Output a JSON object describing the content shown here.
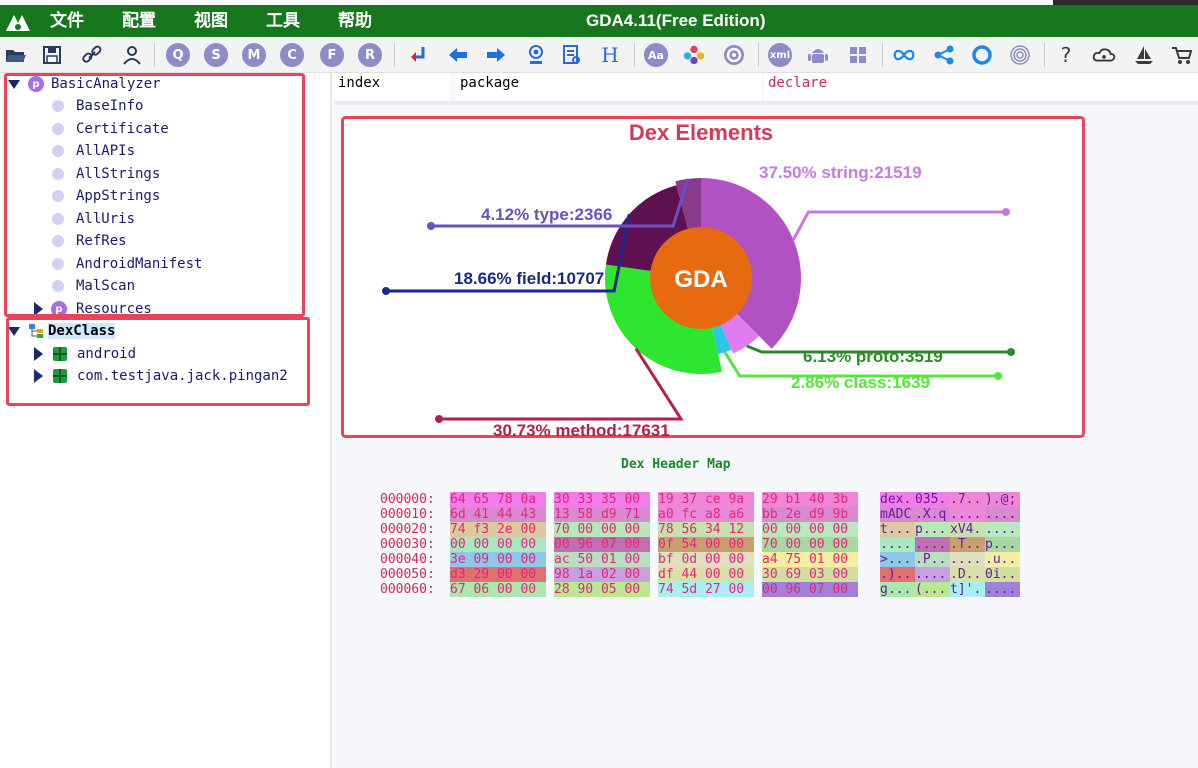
{
  "window": {
    "title": "GDA4.11(Free Edition)",
    "menu": [
      "文件",
      "配置",
      "视图",
      "工具",
      "帮助"
    ]
  },
  "toolbar": {
    "icons": [
      "open-folder-icon",
      "save-icon",
      "link-icon",
      "user-icon",
      "q-icon",
      "s-icon",
      "m-icon",
      "c-icon",
      "f-icon",
      "r-icon",
      "return-icon",
      "back-arrow-icon",
      "forward-arrow-icon",
      "location-icon",
      "report-icon",
      "h-icon",
      "aa-icon",
      "palette-icon",
      "settings-icon",
      "xml-icon",
      "android-icon",
      "windows-icon",
      "infinity-icon",
      "share-icon",
      "circle-icon",
      "fingerprint-icon",
      "help-icon",
      "cloud-icon",
      "boat-icon",
      "cart-icon"
    ],
    "letter_buttons": [
      "Q",
      "S",
      "M",
      "C",
      "F",
      "R"
    ],
    "help_glyph": "?",
    "h_glyph": "H",
    "aa_glyph": "Aa",
    "xml_glyph": "xml"
  },
  "tree": {
    "analyzer": {
      "label": "BasicAnalyzer",
      "children": [
        "BaseInfo",
        "Certificate",
        "AllAPIs",
        "AllStrings",
        "AppStrings",
        "AllUris",
        "RefRes",
        "AndroidManifest",
        "MalScan"
      ],
      "resources": "Resources"
    },
    "dexclass": {
      "label": "DexClass",
      "packages": [
        "android",
        "com.testjava.jack.pingan2"
      ]
    },
    "icon_glyph": "p"
  },
  "columns": [
    "index",
    "package",
    "declare"
  ],
  "chart_data": {
    "type": "pie",
    "title": "Dex Elements",
    "center_label": "GDA",
    "slices": [
      {
        "label": "37.50% string:21519",
        "percent": 37.5,
        "value": 21519,
        "color": "#b052c4",
        "label_color": "#c77be0"
      },
      {
        "label": "6.13% proto:3519",
        "percent": 6.13,
        "value": 3519,
        "color": "#e27af0",
        "label_color": "#2c8a2a"
      },
      {
        "label": "2.86% class:1639",
        "percent": 2.86,
        "value": 1639,
        "color": "#29c6ea",
        "label_color": "#56e63c"
      },
      {
        "label": "30.73% method:17631",
        "percent": 30.73,
        "value": 17631,
        "color": "#2ee630",
        "label_color": "#b3204c"
      },
      {
        "label": "18.66% field:10707",
        "percent": 18.66,
        "value": 10707,
        "color": "#5e1050",
        "label_color": "#1a2a82"
      },
      {
        "label": "4.12% type:2366",
        "percent": 4.12,
        "value": 2366,
        "color": "#8a3a8c",
        "label_color": "#6a50c0"
      }
    ]
  },
  "hexmap": {
    "title": "Dex Header Map",
    "rows": [
      {
        "offset": "000000:",
        "groups": [
          "64 65 78 0a",
          "30 33 35 00",
          "19 37 ce 9a",
          "29 b1 40 3b"
        ],
        "ascii": [
          "dex.",
          "035.",
          ".7..",
          ").@;"
        ]
      },
      {
        "offset": "000010:",
        "groups": [
          "6d 41 44 43",
          "13 58 d9 71",
          "a0 fc a8 a6",
          "bb 2e d9 9b"
        ],
        "ascii": [
          "mADC",
          ".X.q",
          "....",
          "...."
        ]
      },
      {
        "offset": "000020:",
        "groups": [
          "74 f3 2e 00",
          "70 00 00 00",
          "78 56 34 12",
          "00 00 00 00"
        ],
        "ascii": [
          "t...",
          "p...",
          "xV4.",
          "...."
        ]
      },
      {
        "offset": "000030:",
        "groups": [
          "00 00 00 00",
          "00 96 07 00",
          "0f 54 00 00",
          "70 00 00 00"
        ],
        "ascii": [
          "....",
          "....",
          ".T..",
          "p..."
        ]
      },
      {
        "offset": "000040:",
        "groups": [
          "3e 09 00 00",
          "ac 50 01 00",
          "bf 0d 00 00",
          "a4 75 01 00"
        ],
        "ascii": [
          ">...",
          ".P..",
          "....",
          ".u.."
        ]
      },
      {
        "offset": "000050:",
        "groups": [
          "d3 29 00 00",
          "98 1a 02 00",
          "df 44 00 00",
          "30 69 03 00"
        ],
        "ascii": [
          ".)..",
          "....",
          ".D..",
          "0i.."
        ]
      },
      {
        "offset": "000060:",
        "groups": [
          "67 06 00 00",
          "28 90 05 00",
          "74 5d 27 00",
          "00 96 07 00"
        ],
        "ascii": [
          "g...",
          "(...",
          "t]'.",
          "...."
        ]
      }
    ],
    "colors": [
      [
        "#f27ce8",
        "#f27ce8",
        "#ef86d8",
        "#ef86d8"
      ],
      [
        "#d78ad0",
        "#d78ad0",
        "#e98ad8",
        "#d78ad0"
      ],
      [
        "#dcc9a0",
        "#b8e8b8",
        "#c8e0b0",
        "#b8e8c0"
      ],
      [
        "#a8e8c0",
        "#c070b0",
        "#c8a070",
        "#a8d8a0"
      ],
      [
        "#8ec8e8",
        "#b8e0c0",
        "#e0e0c0",
        "#f2f0a0"
      ],
      [
        "#e07070",
        "#c8a0e0",
        "#d8e0a8",
        "#d0e0a0"
      ],
      [
        "#a8e8a8",
        "#b8e890",
        "#a8f0f0",
        "#a080d8"
      ]
    ]
  }
}
